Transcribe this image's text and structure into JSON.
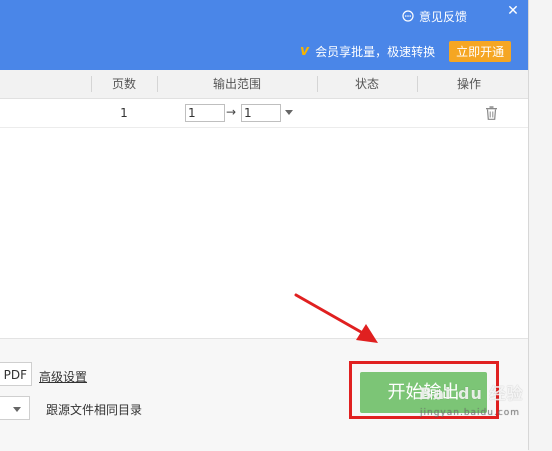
{
  "header": {
    "feedback_label": "意见反馈",
    "close_glyph": "✕",
    "vip_mark": "v",
    "vip_text": "会员享批量，极速转换",
    "open_button": "立即开通"
  },
  "table": {
    "columns": [
      "页数",
      "输出范围",
      "状态",
      "操作"
    ],
    "rows": [
      {
        "pages": "1",
        "range_from": "1",
        "range_arrow": "→",
        "range_to": "1",
        "status": ""
      }
    ]
  },
  "bottom": {
    "format_value": "PDF",
    "advanced_settings": "高级设置",
    "output_dir_label": "跟源文件相同目录",
    "start_button": "开始输出"
  },
  "watermark": {
    "text": "Bai du 经验",
    "sub": "jingyan.baidu.com"
  },
  "colors": {
    "header": "#4a86e8",
    "vip_button": "#f5a623",
    "start_button": "#7cc576",
    "annotation": "#e02020"
  }
}
